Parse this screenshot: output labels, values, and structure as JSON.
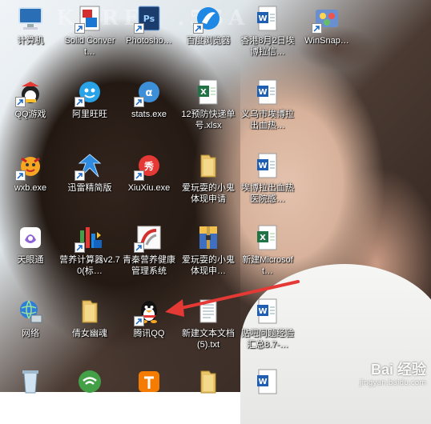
{
  "watermarks": {
    "top": "KOREA .5SA",
    "baidu_main": "Bai 经验",
    "baidu_sub": "jingyan.baidu.com"
  },
  "colors": {
    "arrow": "#e53935",
    "label_text": "#ffffff"
  },
  "desktop_icons": [
    {
      "label": "计算机",
      "icon": "computer-icon"
    },
    {
      "label": "Solid Convert…",
      "icon": "solid-converter-icon"
    },
    {
      "label": "Photosho…",
      "icon": "photoshop-icon"
    },
    {
      "label": "百度浏览器",
      "icon": "baidu-browser-icon"
    },
    {
      "label": "香港8月2日埃博拉信…",
      "icon": "word-doc-icon"
    },
    {
      "label": "WinSnap…",
      "icon": "winsnap-icon"
    },
    {
      "label": "QQ游戏",
      "icon": "qq-game-icon"
    },
    {
      "label": "阿里旺旺",
      "icon": "aliwangwang-icon"
    },
    {
      "label": "stats.exe",
      "icon": "stats-exe-icon"
    },
    {
      "label": "12预防快递单号.xlsx",
      "icon": "excel-file-icon"
    },
    {
      "label": "义乌市埃博拉出血热…",
      "icon": "word-doc-icon"
    },
    {
      "label": "wxb.exe",
      "icon": "wxb-exe-icon"
    },
    {
      "label": "迅雷精简版",
      "icon": "xunlei-icon"
    },
    {
      "label": "XiuXiu.exe",
      "icon": "xiuxiu-icon"
    },
    {
      "label": "爱玩耍的小鬼体现申请",
      "icon": "folder-icon"
    },
    {
      "label": "埃博拉出血热医院感…",
      "icon": "word-doc-icon"
    },
    {
      "label": "天眼通",
      "icon": "tianyantong-icon"
    },
    {
      "label": "营养计算器v2.70(标…",
      "icon": "nutrition-calculator-icon"
    },
    {
      "label": "青秦营养健康管理系统",
      "icon": "health-system-icon"
    },
    {
      "label": "爱玩耍的小鬼体现申…",
      "icon": "archive-icon"
    },
    {
      "label": "新建Microsoft…",
      "icon": "excel-file-icon"
    },
    {
      "label": "网络",
      "icon": "network-icon"
    },
    {
      "label": "倩女幽魂",
      "icon": "folder-icon"
    },
    {
      "label": "腾讯QQ",
      "icon": "qq-icon"
    },
    {
      "label": "新建文本文档 (5).txt",
      "icon": "text-file-icon"
    },
    {
      "label": "贴吧问题经验汇总8.7-…",
      "icon": "word-doc-icon"
    },
    {
      "label": "",
      "icon": "recycle-bin-icon"
    },
    {
      "label": "",
      "icon": "wifi-app-icon"
    },
    {
      "label": "",
      "icon": "orange-app-icon"
    },
    {
      "label": "",
      "icon": "folder-icon"
    },
    {
      "label": "",
      "icon": "word-doc-icon"
    }
  ]
}
